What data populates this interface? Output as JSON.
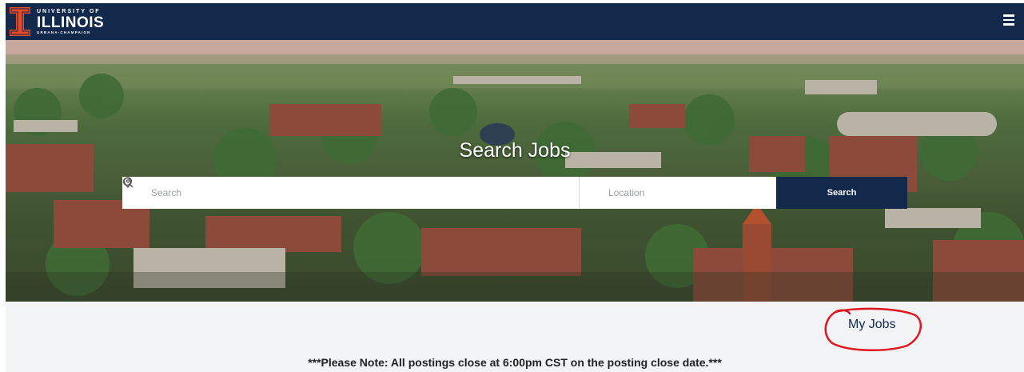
{
  "header": {
    "logo_top": "UNIVERSITY OF",
    "logo_main": "ILLINOIS",
    "logo_bottom": "URBANA-CHAMPAIGN",
    "menu_icon": "hamburger-menu-icon"
  },
  "hero": {
    "title": "Search Jobs",
    "search_placeholder": "Search",
    "location_placeholder": "Location",
    "search_button_label": "Search"
  },
  "links": {
    "my_jobs": "My Jobs"
  },
  "notice": {
    "text": "***Please Note: All postings close at 6:00pm CST on the posting close date.***"
  },
  "colors": {
    "brand_navy": "#13294b",
    "brand_orange": "#e84a27",
    "annotation_red": "#e0141e"
  }
}
